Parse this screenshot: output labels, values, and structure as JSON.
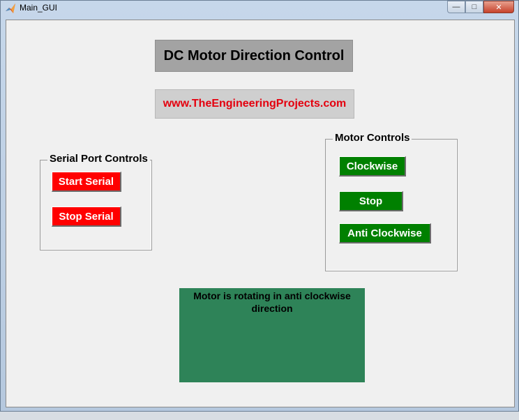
{
  "window": {
    "title": "Main_GUI"
  },
  "header": {
    "title": "DC Motor Direction Control",
    "link": "www.TheEngineeringProjects.com"
  },
  "serial_panel": {
    "title": "Serial Port Controls",
    "start_label": "Start Serial",
    "stop_label": "Stop Serial"
  },
  "motor_panel": {
    "title": "Motor Controls",
    "clockwise_label": "Clockwise",
    "stop_label": "Stop",
    "anticlockwise_label": "Anti Clockwise"
  },
  "status": {
    "text": "Motor is rotating in anti clockwise direction"
  },
  "colors": {
    "red_button": "#ff0000",
    "green_button": "#008000",
    "status_bg": "#2e8358",
    "link_text": "#e4000e"
  }
}
